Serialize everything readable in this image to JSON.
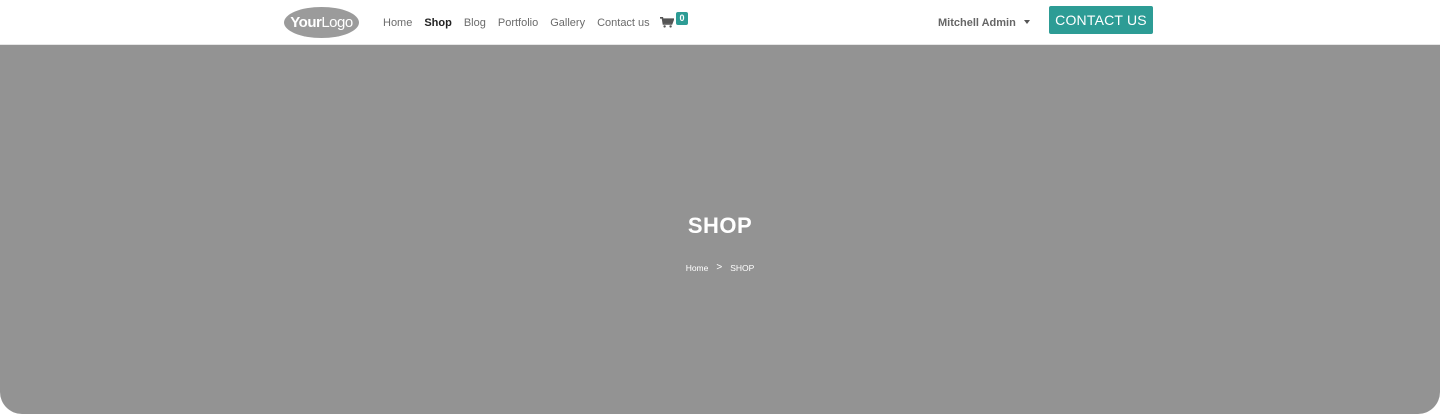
{
  "brand": {
    "logo_bold": "Your",
    "logo_light": "Logo"
  },
  "nav": {
    "items": [
      {
        "label": "Home"
      },
      {
        "label": "Shop",
        "active": true
      },
      {
        "label": "Blog"
      },
      {
        "label": "Portfolio"
      },
      {
        "label": "Gallery"
      },
      {
        "label": "Contact us"
      }
    ]
  },
  "cart": {
    "count": "0",
    "icon": "cart-icon"
  },
  "user": {
    "name": "Mitchell Admin",
    "icon": "caret-down-icon"
  },
  "cta": {
    "label": "CONTACT US"
  },
  "hero": {
    "title": "SHOP",
    "breadcrumb": {
      "home": "Home",
      "separator": ">",
      "current": "SHOP"
    }
  },
  "colors": {
    "accent": "#2d9c95",
    "hero_bg": "#939393"
  }
}
